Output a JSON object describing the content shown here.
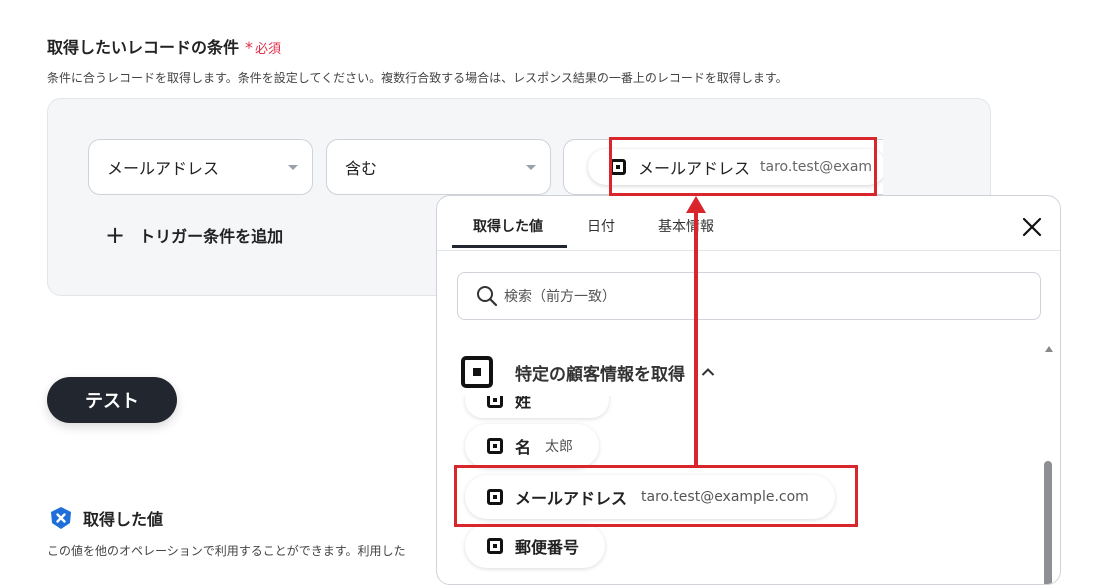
{
  "section": {
    "title": "取得したいレコードの条件",
    "required_star": "*",
    "required_label": "必須",
    "description": "条件に合うレコードを取得します。条件を設定してください。複数行合致する場合は、レスポンス結果の一番上のレコードを取得します。"
  },
  "condition": {
    "field_select": "メールアドレス",
    "operator_select": "含む",
    "value_chip_label": "メールアドレス",
    "value_chip_value": "taro.test@exam",
    "add_trigger_label": "トリガー条件を追加"
  },
  "test_button": "テスト",
  "acquired": {
    "title": "取得した値",
    "description": "この値を他のオペレーションで利用することができます。利用した"
  },
  "popup": {
    "tabs": [
      "取得した値",
      "日付",
      "基本情報"
    ],
    "active_tab": "取得した値",
    "search_placeholder": "検索（前方一致）",
    "group_title": "特定の顧客情報を取得",
    "items": [
      {
        "label": "姓",
        "value": ""
      },
      {
        "label": "名",
        "value": "太郎"
      },
      {
        "label": "メールアドレス",
        "value": "taro.test@example.com"
      },
      {
        "label": "郵便番号",
        "value": ""
      }
    ]
  },
  "colors": {
    "accent_dark": "#22262e",
    "highlight_red": "#d9262c",
    "required_red": "#e0314b",
    "info_blue": "#1e6fd9"
  }
}
